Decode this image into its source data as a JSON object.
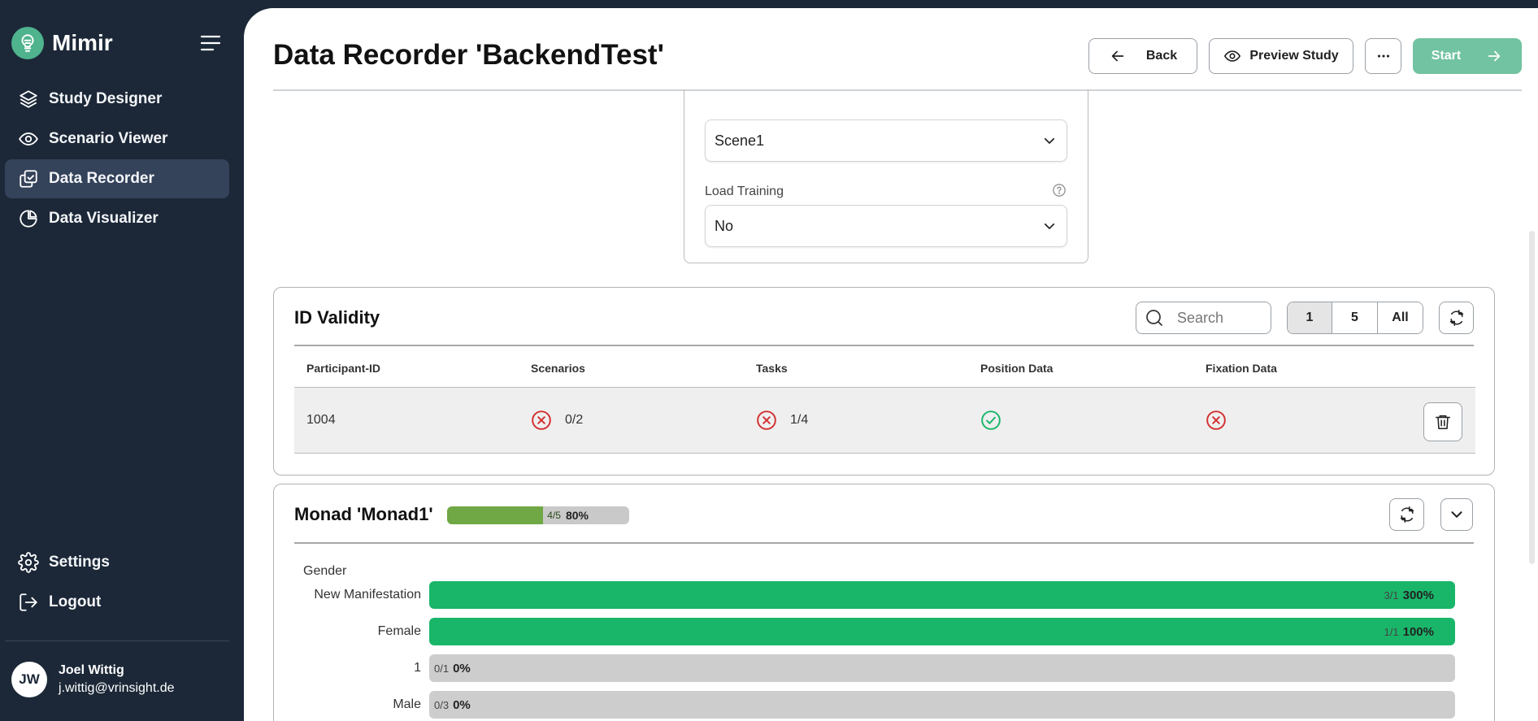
{
  "app": {
    "name": "Mimir"
  },
  "sidebar": {
    "items": [
      {
        "label": "Study Designer",
        "icon": "layers-icon",
        "active": false
      },
      {
        "label": "Scenario Viewer",
        "icon": "eye-icon",
        "active": false
      },
      {
        "label": "Data Recorder",
        "icon": "recorder-icon",
        "active": true
      },
      {
        "label": "Data Visualizer",
        "icon": "pie-chart-icon",
        "active": false
      }
    ],
    "bottom": [
      {
        "label": "Settings",
        "icon": "gear-icon"
      },
      {
        "label": "Logout",
        "icon": "logout-icon"
      }
    ],
    "user": {
      "initials": "JW",
      "name": "Joel Wittig",
      "email": "j.wittig@vrinsight.de"
    }
  },
  "header": {
    "title": "Data Recorder 'BackendTest'",
    "back_label": "Back",
    "preview_label": "Preview Study",
    "start_label": "Start"
  },
  "options": {
    "scene_value": "Scene1",
    "load_training_label": "Load Training",
    "load_training_value": "No"
  },
  "id_validity": {
    "title": "ID Validity",
    "search_placeholder": "Search",
    "pager": [
      "1",
      "5",
      "All"
    ],
    "pager_active": "1",
    "columns": [
      "Participant-ID",
      "Scenarios",
      "Tasks",
      "Position Data",
      "Fixation Data"
    ],
    "rows": [
      {
        "participant_id": "1004",
        "scenarios": {
          "ok": false,
          "value": "0/2"
        },
        "tasks": {
          "ok": false,
          "value": "1/4"
        },
        "position_ok": true,
        "fixation_ok": false
      }
    ]
  },
  "monad": {
    "title": "Monad 'Monad1'",
    "progress": {
      "fraction": "4/5",
      "percent_label": "80%",
      "value": 0.8
    },
    "groups": [
      {
        "label": "Gender",
        "bars": [
          {
            "label": "New Manifestation",
            "fraction": "3/1",
            "percent_label": "300%",
            "value": 3.0
          },
          {
            "label": "Female",
            "fraction": "1/1",
            "percent_label": "100%",
            "value": 1.0
          },
          {
            "label": "1",
            "fraction": "0/1",
            "percent_label": "0%",
            "value": 0.0
          },
          {
            "label": "Male",
            "fraction": "0/3",
            "percent_label": "0%",
            "value": 0.0
          }
        ]
      }
    ]
  },
  "colors": {
    "sidebar_bg": "#1c2838",
    "accent": "#4fb38e",
    "start_button": "#72c3a1",
    "success": "#19b66a",
    "error": "#d32f2f",
    "progress_fill": "#6fa844"
  }
}
